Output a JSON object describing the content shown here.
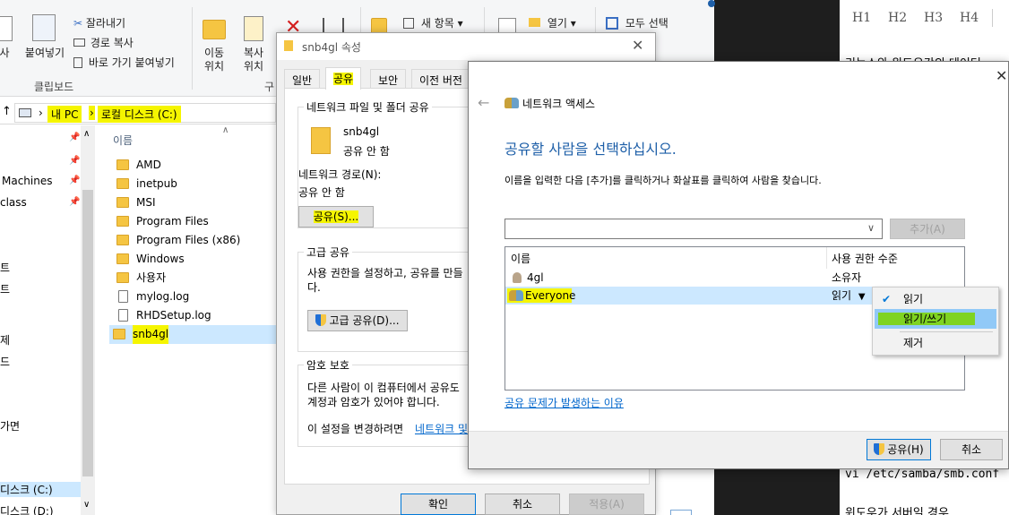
{
  "ribbon": {
    "cut": "잘라내기",
    "copy_path": "경로 복사",
    "paste": "붙여넣기",
    "paste_shortcut": "바로 가기 붙여넣기",
    "clipboard_group": "클립보드",
    "move_to": "이동\n위치",
    "copy_to": "복사\n위치",
    "new_item": "새 항목",
    "open": "열기",
    "select_all": "모두 선택",
    "organize_group_partial": "구",
    "left_partial": "사"
  },
  "address": {
    "crumbs": [
      "내 PC",
      "로컬 디스크 (C:)"
    ]
  },
  "nav": {
    "items": [
      {
        "label": "Machines",
        "pinned": true
      },
      {
        "label": "class",
        "pinned": true
      },
      {
        "label": "트",
        "pinned": false
      },
      {
        "label": "트",
        "pinned": false
      },
      {
        "label": "제",
        "pinned": false
      },
      {
        "label": "드",
        "pinned": false
      },
      {
        "label": "가면",
        "pinned": false
      },
      {
        "label": "디스크 (C:)",
        "pinned": false
      },
      {
        "label": "디스크 (D:)",
        "pinned": false
      }
    ]
  },
  "filelist": {
    "column": "이름",
    "files": [
      {
        "name": "AMD",
        "type": "folder"
      },
      {
        "name": "inetpub",
        "type": "folder"
      },
      {
        "name": "MSI",
        "type": "folder"
      },
      {
        "name": "Program Files",
        "type": "folder"
      },
      {
        "name": "Program Files (x86)",
        "type": "folder"
      },
      {
        "name": "Windows",
        "type": "folder"
      },
      {
        "name": "사용자",
        "type": "folder"
      },
      {
        "name": "mylog.log",
        "type": "file"
      },
      {
        "name": "RHDSetup.log",
        "type": "file"
      },
      {
        "name": "snb4gl",
        "type": "folder",
        "selected": true
      }
    ]
  },
  "props": {
    "title": "snb4gl 속성",
    "tabs": [
      "일반",
      "공유",
      "보안",
      "이전 버전"
    ],
    "active_tab": "공유",
    "net_share_group": "네트워크 파일 및 폴더 공유",
    "folder_name": "snb4gl",
    "share_state": "공유 안 함",
    "net_path_label": "네트워크 경로(N):",
    "net_path_value": "공유 안 함",
    "share_button": "공유(S)...",
    "adv_group": "고급 공유",
    "adv_desc": "사용 권한을 설정하고, 공유를 만들",
    "adv_desc2": "다.",
    "adv_button": "고급 공유(D)...",
    "pw_group": "암호 보호",
    "pw_desc": "다른 사람이 이 컴퓨터에서 공유도",
    "pw_desc2": "계정과 암호가 있어야 합니다.",
    "pw_change": "이 설정을 변경하려면",
    "pw_link": "네트워크 및",
    "ok": "확인",
    "cancel": "취소",
    "apply": "적용(A)"
  },
  "netacc": {
    "title": "네트워크 액세스",
    "heading": "공유할 사람을 선택하십시오.",
    "instruction": "이름을 입력한 다음 [추가]를 클릭하거나 화살표를 클릭하여 사람을 찾습니다.",
    "combo_value": "",
    "add_button": "추가(A)",
    "col_name": "이름",
    "col_perm": "사용 권한 수준",
    "rows": [
      {
        "name": "4gl",
        "perm": "소유자",
        "icon": "user"
      },
      {
        "name": "Everyone",
        "perm": "읽기",
        "icon": "group",
        "selected": true
      }
    ],
    "help_link": "공유 문제가 발생하는 이유",
    "share_button": "공유(H)",
    "cancel_button": "취소"
  },
  "context_menu": {
    "items": [
      {
        "label": "읽기",
        "checked": true
      },
      {
        "label": "읽기/쓰기",
        "hovered": true
      },
      {
        "label": "제거"
      }
    ]
  },
  "blog": {
    "headings": [
      "H1",
      "H2",
      "H3",
      "H4"
    ],
    "line1": "리눅스와 윈도우간의 데이터",
    "code": "vi /etc/samba/smb.conf",
    "line2": "윈도우가 서버일 경우"
  },
  "colors": {
    "highlight": "#f5f500",
    "selection": "#cce8ff",
    "link": "#0066cc",
    "heading_blue": "#1e5fa8",
    "menu_hover": "#91c9f7"
  }
}
